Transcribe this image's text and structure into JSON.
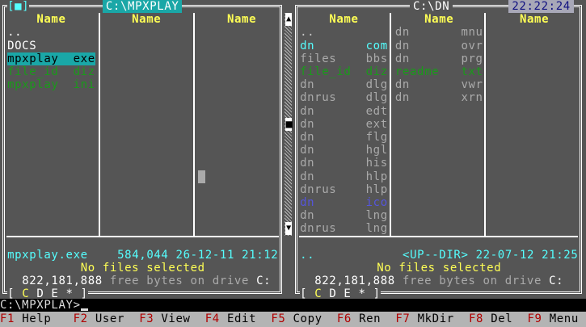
{
  "left_panel": {
    "title": "C:\\MPXPLAY",
    "menu_marker": "[■]",
    "column_header": "Name",
    "files": [
      {
        "name": "..",
        "ext": "",
        "color": "#ffffff"
      },
      {
        "name": "DOCS",
        "ext": "",
        "color": "#ffffff"
      },
      {
        "name": "mpxplay",
        "ext": "exe",
        "color": "#000000",
        "selected": true
      },
      {
        "name": "file_id",
        "ext": "diz",
        "color": "#1a9a1a"
      },
      {
        "name": "mpxplay",
        "ext": "ini",
        "color": "#1a9a1a"
      }
    ],
    "info": {
      "name": "mpxplay.exe",
      "details": "584,044 26-12-11 21:12"
    },
    "selection_status": "No files selected",
    "free_bytes": "822,181,888",
    "free_text": " free bytes on drive ",
    "drive": "C:",
    "drives": {
      "open": "[",
      "active": "C",
      "others": "D E *",
      "close": "]"
    }
  },
  "right_panel": {
    "title": "C:\\DN",
    "clock": "22:22:24",
    "column_header": "Name",
    "files_col1": [
      {
        "name": "..",
        "ext": "",
        "color": "#c8c8c8"
      },
      {
        "name": "dn",
        "ext": "com",
        "color": "#55ffff"
      },
      {
        "name": "files",
        "ext": "bbs",
        "color": "#aaaaaa"
      },
      {
        "name": "file_id",
        "ext": "diz",
        "color": "#1a9a1a"
      },
      {
        "name": "dn",
        "ext": "dlg",
        "color": "#aaaaaa"
      },
      {
        "name": "dnrus",
        "ext": "dlg",
        "color": "#aaaaaa"
      },
      {
        "name": "dn",
        "ext": "edt",
        "color": "#aaaaaa"
      },
      {
        "name": "dn",
        "ext": "ext",
        "color": "#aaaaaa"
      },
      {
        "name": "dn",
        "ext": "flg",
        "color": "#aaaaaa"
      },
      {
        "name": "dn",
        "ext": "hgl",
        "color": "#aaaaaa"
      },
      {
        "name": "dn",
        "ext": "his",
        "color": "#aaaaaa"
      },
      {
        "name": "dn",
        "ext": "hlp",
        "color": "#aaaaaa"
      },
      {
        "name": "dnrus",
        "ext": "hlp",
        "color": "#aaaaaa"
      },
      {
        "name": "dn",
        "ext": "ico",
        "color": "#5555dd"
      },
      {
        "name": "dn",
        "ext": "lng",
        "color": "#aaaaaa"
      },
      {
        "name": "dnrus",
        "ext": "lng",
        "color": "#aaaaaa"
      }
    ],
    "files_col2": [
      {
        "name": "dn",
        "ext": "mnu",
        "color": "#aaaaaa"
      },
      {
        "name": "dn",
        "ext": "ovr",
        "color": "#aaaaaa"
      },
      {
        "name": "dn",
        "ext": "prg",
        "color": "#aaaaaa"
      },
      {
        "name": "readme",
        "ext": "txt",
        "color": "#1a9a1a"
      },
      {
        "name": "dn",
        "ext": "vwr",
        "color": "#aaaaaa"
      },
      {
        "name": "dn",
        "ext": "xrn",
        "color": "#aaaaaa"
      }
    ],
    "info": {
      "name": "..",
      "details": "<UP--DIR> 22-07-12 21:25"
    },
    "selection_status": "No files selected",
    "free_bytes": "822,181,888",
    "free_text": " free bytes on drive ",
    "drive": "C:",
    "drives": {
      "open": "[",
      "active": "C",
      "others": "D E *",
      "close": "]"
    }
  },
  "command_line": "C:\\MPXPLAY>",
  "function_keys": [
    {
      "key": "F1",
      "label": "Help"
    },
    {
      "key": "F2",
      "label": "User"
    },
    {
      "key": "F3",
      "label": "View"
    },
    {
      "key": "F4",
      "label": "Edit"
    },
    {
      "key": "F5",
      "label": "Copy"
    },
    {
      "key": "F6",
      "label": "Ren"
    },
    {
      "key": "F7",
      "label": "MkDir"
    },
    {
      "key": "F8",
      "label": "Del"
    },
    {
      "key": "F9",
      "label": "Menu"
    }
  ],
  "colors": {
    "panel_bg": "#555555",
    "header": "#ffff55",
    "highlight": "#1aa7a7",
    "key": "#b00000"
  }
}
